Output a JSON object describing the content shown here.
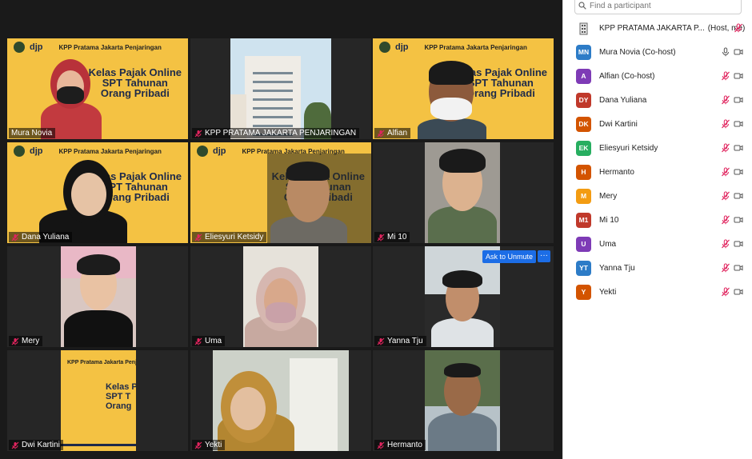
{
  "gallery": {
    "slide": {
      "brand": "djp",
      "office": "KPP Pratama Jakarta Penjaringan",
      "line1": "Kelas Pajak Online",
      "line2": "SPT Tahunan",
      "line3": "Orang Pribadi"
    },
    "tiles": [
      {
        "name": "Mura Novia",
        "muted": false
      },
      {
        "name": "KPP PRATAMA JAKARTA PENJARINGAN",
        "muted": true
      },
      {
        "name": "Alfian",
        "muted": true
      },
      {
        "name": "Dana Yuliana",
        "muted": true
      },
      {
        "name": "Eliesyuri Ketsidy",
        "muted": true
      },
      {
        "name": "Mi 10",
        "muted": true
      },
      {
        "name": "Mery",
        "muted": true
      },
      {
        "name": "Uma",
        "muted": true
      },
      {
        "name": "Yanna Tju",
        "muted": true
      },
      {
        "name": "Dwi Kartini",
        "muted": true
      },
      {
        "name": "Yekti",
        "muted": true
      },
      {
        "name": "Hermanto",
        "muted": true
      }
    ],
    "ask_to_unmute": "Ask to Unmute",
    "more": "···"
  },
  "panel": {
    "search_placeholder": "Find a participant",
    "participants": [
      {
        "initials": "",
        "name": "KPP PRATAMA JAKARTA P...",
        "role": "(Host, me)",
        "color": "#ffffff",
        "mic": "muted",
        "video": false
      },
      {
        "initials": "MN",
        "name": "Mura Novia (Co-host)",
        "role": "",
        "color": "#2d7cc7",
        "mic": "on",
        "video": true
      },
      {
        "initials": "A",
        "name": "Alfian (Co-host)",
        "role": "",
        "color": "#7e3bb6",
        "mic": "muted",
        "video": true
      },
      {
        "initials": "DY",
        "name": "Dana Yuliana",
        "role": "",
        "color": "#c0392b",
        "mic": "muted",
        "video": true
      },
      {
        "initials": "DK",
        "name": "Dwi Kartini",
        "role": "",
        "color": "#d35400",
        "mic": "muted",
        "video": true
      },
      {
        "initials": "EK",
        "name": "Eliesyuri Ketsidy",
        "role": "",
        "color": "#27ae60",
        "mic": "muted",
        "video": true
      },
      {
        "initials": "H",
        "name": "Hermanto",
        "role": "",
        "color": "#d35400",
        "mic": "muted",
        "video": true
      },
      {
        "initials": "M",
        "name": "Mery",
        "role": "",
        "color": "#f39c12",
        "mic": "muted",
        "video": true
      },
      {
        "initials": "M1",
        "name": "Mi 10",
        "role": "",
        "color": "#c0392b",
        "mic": "muted",
        "video": true
      },
      {
        "initials": "U",
        "name": "Uma",
        "role": "",
        "color": "#7e3bb6",
        "mic": "muted",
        "video": true
      },
      {
        "initials": "YT",
        "name": "Yanna Tju",
        "role": "",
        "color": "#2d7cc7",
        "mic": "muted",
        "video": true
      },
      {
        "initials": "Y",
        "name": "Yekti",
        "role": "",
        "color": "#d35400",
        "mic": "muted",
        "video": true
      }
    ]
  },
  "colors": {
    "accent": "#1c6de6",
    "slide_yellow": "#f4c243",
    "muted_red": "#e0245e",
    "active_border": "#d7e44a"
  }
}
